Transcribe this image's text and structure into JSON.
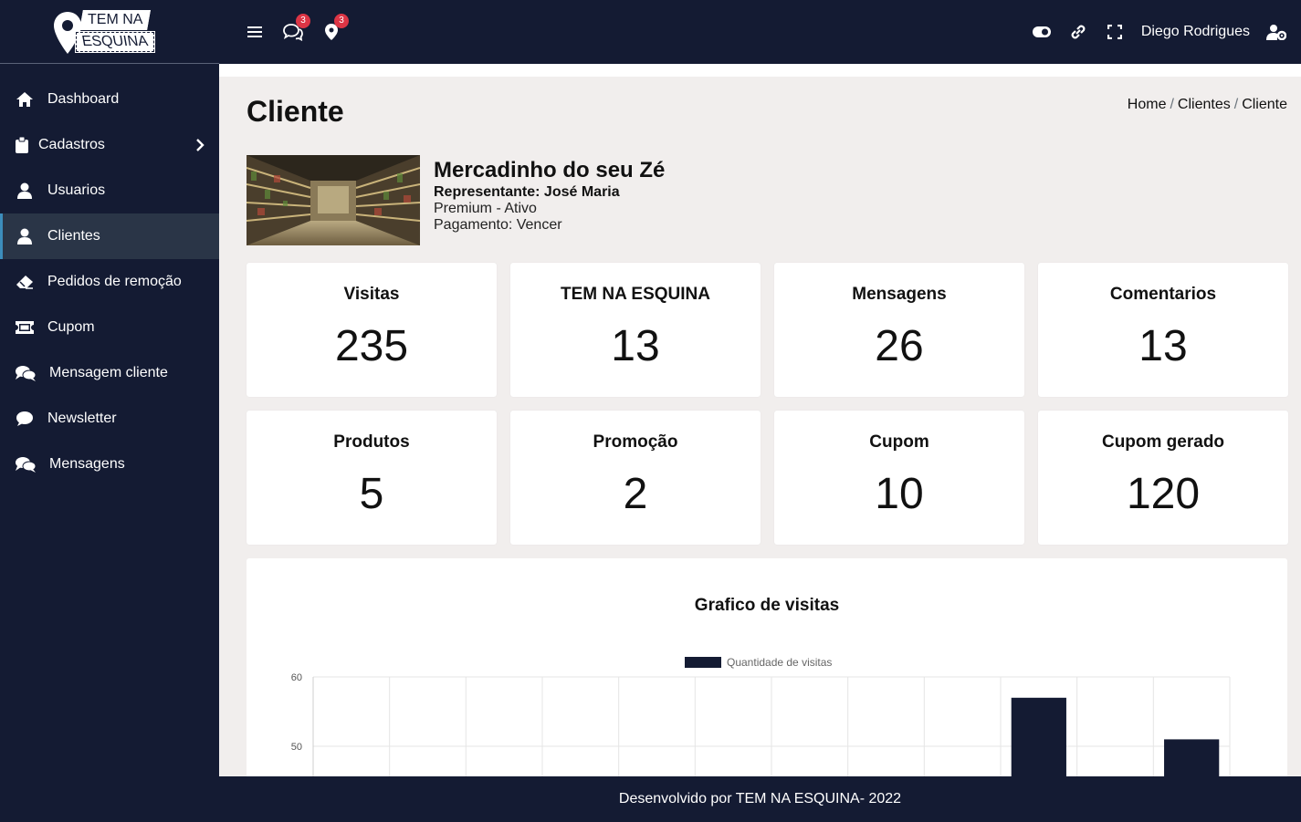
{
  "brand": {
    "line1": "TEM NA",
    "line2": "ESQUINA"
  },
  "sidebar": {
    "items": [
      {
        "label": "Dashboard",
        "icon": "home-icon"
      },
      {
        "label": "Cadastros",
        "icon": "clipboard-icon"
      },
      {
        "label": "Usuarios",
        "icon": "user-icon"
      },
      {
        "label": "Clientes",
        "icon": "user-icon"
      },
      {
        "label": "Pedidos de remoção",
        "icon": "eraser-icon"
      },
      {
        "label": "Cupom",
        "icon": "ticket-icon"
      },
      {
        "label": "Mensagem cliente",
        "icon": "comments-icon"
      },
      {
        "label": "Newsletter",
        "icon": "comment-icon"
      },
      {
        "label": "Mensagens",
        "icon": "comments-icon"
      }
    ]
  },
  "topbar": {
    "messages_badge": "3",
    "locations_badge": "3",
    "user_name": "Diego Rodrigues"
  },
  "page": {
    "title": "Cliente",
    "breadcrumb": {
      "home": "Home",
      "section": "Clientes",
      "current": "Cliente",
      "sep": "/"
    }
  },
  "client": {
    "name": "Mercadinho do seu Zé",
    "representative": "Representante: José Maria",
    "plan": "Premium - Ativo",
    "payment": "Pagamento: Vencer"
  },
  "stats": [
    {
      "label": "Visitas",
      "value": "235"
    },
    {
      "label": "TEM NA ESQUINA",
      "value": "13"
    },
    {
      "label": "Mensagens",
      "value": "26"
    },
    {
      "label": "Comentarios",
      "value": "13"
    },
    {
      "label": "Produtos",
      "value": "5"
    },
    {
      "label": "Promoção",
      "value": "2"
    },
    {
      "label": "Cupom",
      "value": "10"
    },
    {
      "label": "Cupom gerado",
      "value": "120"
    }
  ],
  "chart_title": "Grafico de visitas",
  "chart_data": {
    "type": "bar",
    "title": "Grafico de visitas",
    "legend": "Quantidade de visitas",
    "legend_placement": "top",
    "categories_count": 12,
    "values": [
      null,
      null,
      null,
      null,
      null,
      null,
      null,
      null,
      null,
      57,
      null,
      51
    ],
    "yticks": [
      "60",
      "50"
    ],
    "ylim": [
      45,
      60
    ],
    "grid": true,
    "color": "#141b33"
  },
  "footer": {
    "text": "Desenvolvido por TEM NA ESQUINA- 2022"
  },
  "colors": {
    "navy": "#141b33",
    "active": "#2a3547",
    "badge": "#dc3545",
    "background": "#f1eeed"
  }
}
